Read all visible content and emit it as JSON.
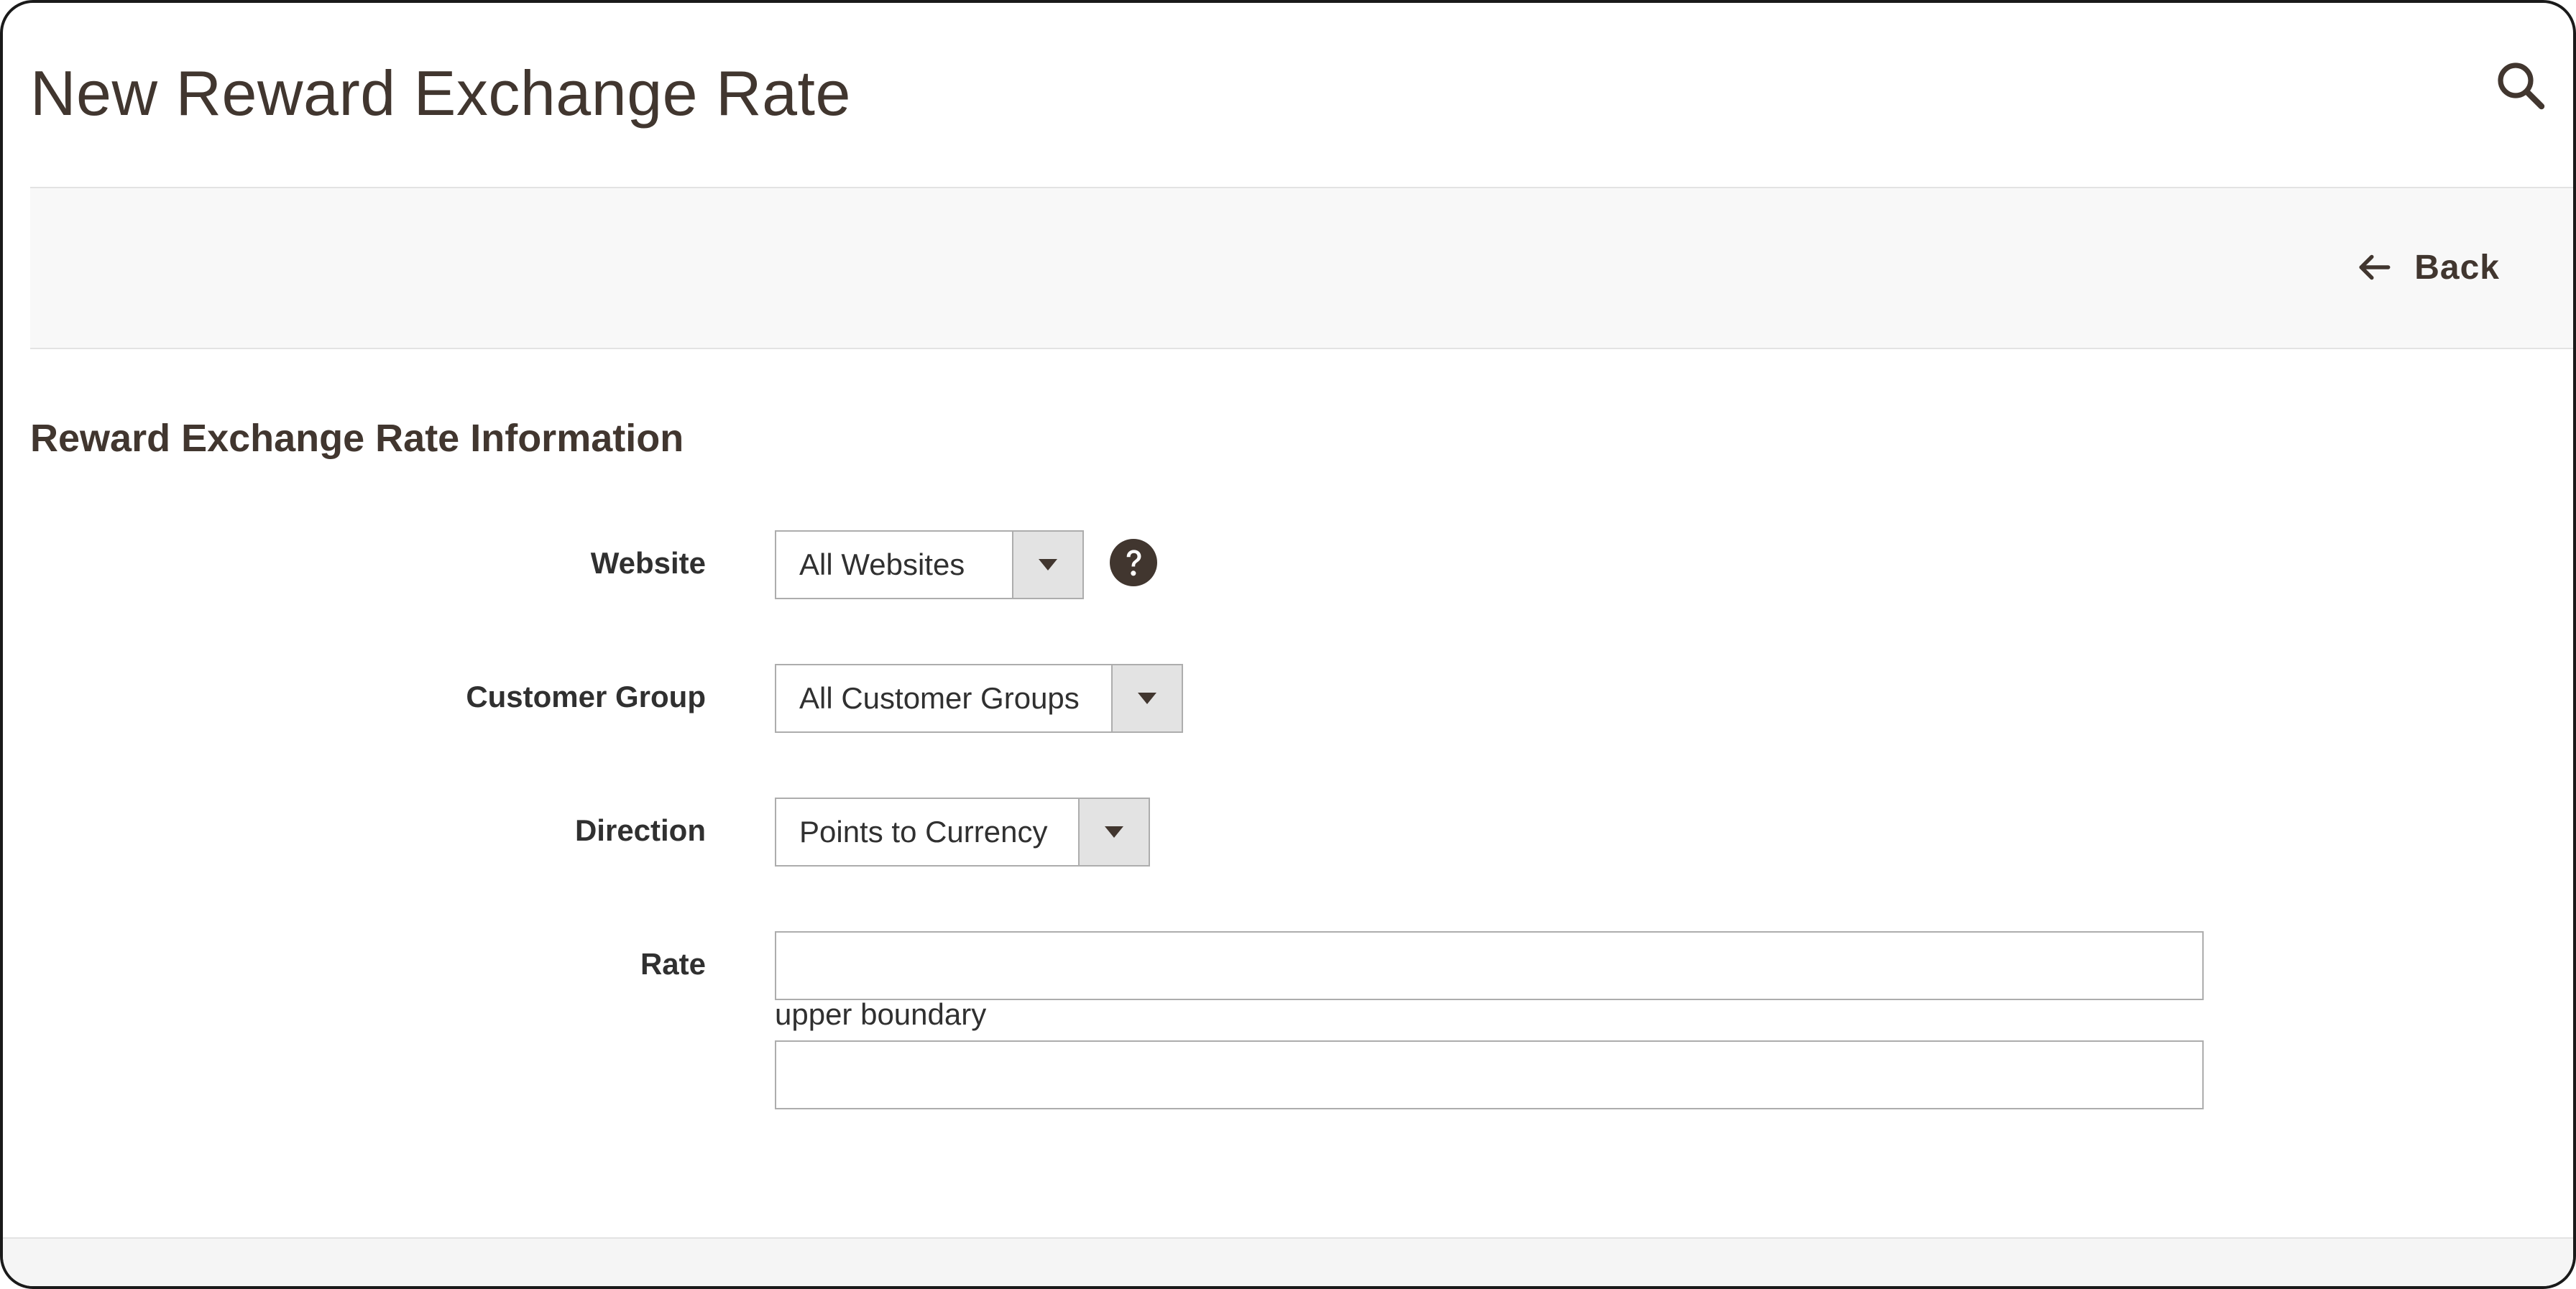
{
  "page": {
    "title": "New Reward Exchange Rate"
  },
  "header": {
    "search_icon": "search-icon"
  },
  "actions": {
    "back_label": "Back",
    "back_icon": "arrow-left-icon"
  },
  "section": {
    "title": "Reward Exchange Rate Information"
  },
  "form": {
    "website": {
      "label": "Website",
      "value": "All Websites",
      "help_icon": "question-circle-icon"
    },
    "customer_group": {
      "label": "Customer Group",
      "value": "All Customer Groups"
    },
    "direction": {
      "label": "Direction",
      "value": "Points to Currency"
    },
    "rate": {
      "label": "Rate",
      "value": "",
      "upper_boundary_label": "upper boundary",
      "upper_boundary_value": ""
    }
  },
  "colors": {
    "title_text": "#41362f",
    "border": "#adadad",
    "action_bar_bg": "#f8f8f8",
    "toggle_bg": "#e3e3e3"
  }
}
